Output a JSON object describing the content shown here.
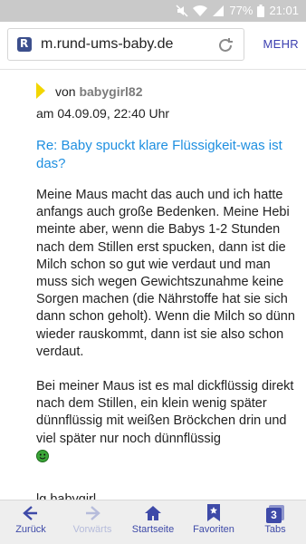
{
  "status_bar": {
    "battery": "77%",
    "time": "21:01"
  },
  "browser": {
    "url": "m.rund-ums-baby.de",
    "favicon_letter": "R",
    "more_label": "MEHR"
  },
  "post": {
    "author_prefix": "von",
    "author": "babygirl82",
    "date": "am 04.09.09, 22:40 Uhr",
    "title": "Re: Baby spuckt klare Flüssigkeit-was ist das?",
    "paragraph_1": "Meine Maus macht das auch und ich hatte anfangs auch große Bedenken. Meine Hebi meinte aber, wenn die Babys 1-2 Stunden nach dem Stillen erst spucken, dann ist die Milch schon so gut wie verdaut und man muss sich wegen Gewichtszunahme keine Sorgen machen (die Nährstoffe hat sie sich dann schon geholt). Wenn die Milch so dünn wieder rauskommt, dann ist sie also schon verdaut.",
    "paragraph_2": "Bei meiner Maus ist es mal dickflüssig direkt nach dem Stillen, ein klein wenig später dünnflüssig mit weißen Bröckchen drin und viel später nur noch dünnflüssig",
    "signature": "lg babygirl"
  },
  "toolbar": {
    "back_label": "Zurück",
    "forward_label": "Vorwärts",
    "home_label": "Startseite",
    "favorites_label": "Favoriten",
    "tabs_label": "Tabs",
    "tabs_count": "3"
  },
  "colors": {
    "accent": "#3e4aa8",
    "link": "#1e8fe0",
    "flag": "#f2d600",
    "smiley": "#3aa637"
  }
}
